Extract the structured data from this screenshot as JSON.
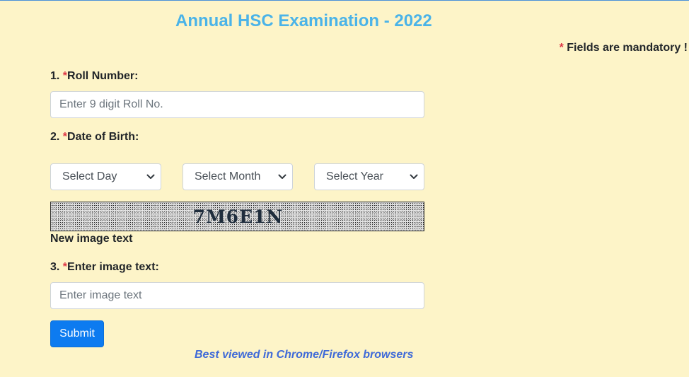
{
  "header": {
    "title": "Annual HSC Examination - 2022",
    "mandatory_star": "*",
    "mandatory_text": " Fields are mandatory !"
  },
  "form": {
    "roll": {
      "number": "1. ",
      "star": "*",
      "label": "Roll Number:",
      "placeholder": "Enter 9 digit Roll No."
    },
    "dob": {
      "number": "2. ",
      "star": "*",
      "label": "Date of Birth:",
      "day": "Select Day",
      "month": "Select Month",
      "year": "Select Year"
    },
    "captcha": {
      "code": "7M6E1N",
      "refresh_label": "New image text"
    },
    "image_text": {
      "number": "3. ",
      "star": "*",
      "label": "Enter image text:",
      "placeholder": "Enter image text"
    },
    "submit_label": "Submit"
  },
  "footer": {
    "note": "Best viewed in Chrome/Firefox browsers"
  },
  "colors": {
    "background": "#fdf4c8",
    "title": "#4ab3e8",
    "required": "#dc3545",
    "button": "#0d7bf0",
    "footer": "#3f6ad8"
  },
  "icons": {
    "select_arrow": "chevron-down-icon"
  }
}
